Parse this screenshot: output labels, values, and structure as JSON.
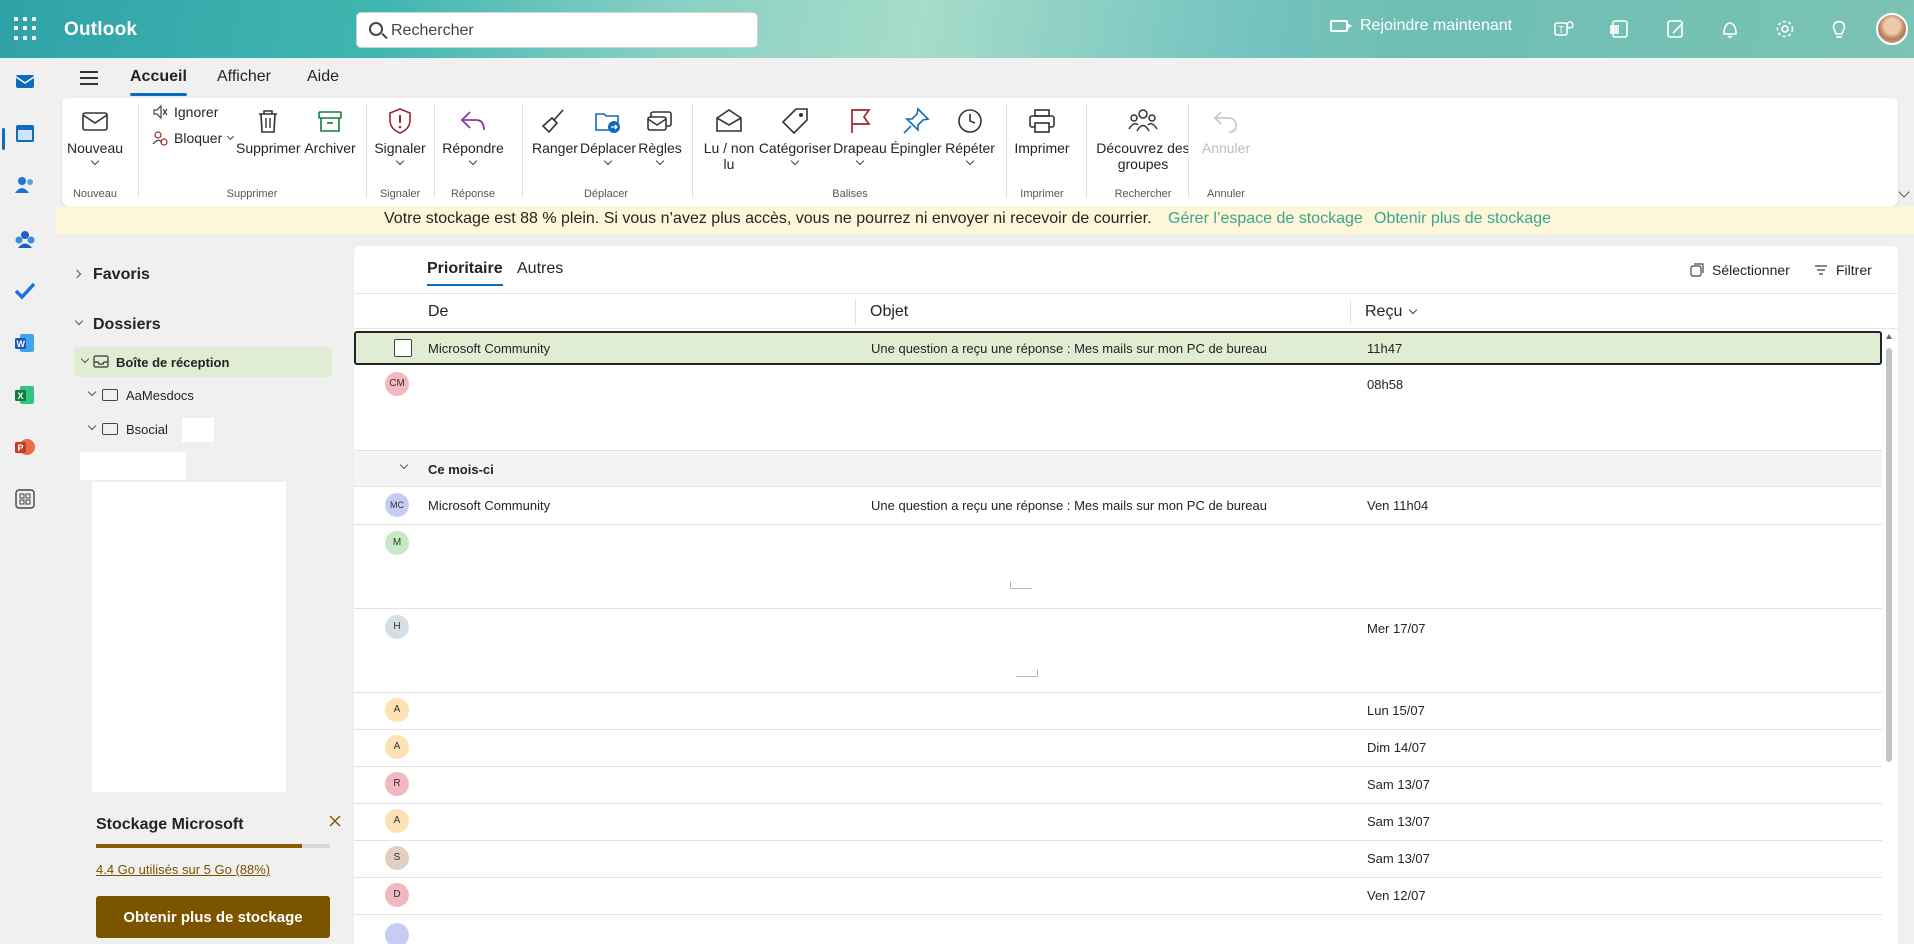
{
  "topbar": {
    "app_name": "Outlook",
    "search_placeholder": "Rechercher",
    "join_label": "Rejoindre maintenant"
  },
  "ribbon": {
    "tabs": [
      "Accueil",
      "Afficher",
      "Aide"
    ],
    "buttons": {
      "nouveau": "Nouveau",
      "ignorer": "Ignorer",
      "bloquer": "Bloquer",
      "supprimer": "Supprimer",
      "archiver": "Archiver",
      "signaler": "Signaler",
      "repondre": "Répondre",
      "ranger": "Ranger",
      "deplacer": "Déplacer",
      "regles": "Règles",
      "lu_non_lu_1": "Lu / non",
      "lu_non_lu_2": "lu",
      "categoriser": "Catégoriser",
      "drapeau": "Drapeau",
      "epingler": "Épingler",
      "repeter": "Répéter",
      "imprimer": "Imprimer",
      "groupes_1": "Découvrez des",
      "groupes_2": "groupes",
      "annuler": "Annuler"
    },
    "groups": {
      "nouveau": "Nouveau",
      "supprimer": "Supprimer",
      "signaler": "Signaler",
      "reponse": "Réponse",
      "deplacer": "Déplacer",
      "balises": "Balises",
      "imprimer": "Imprimer",
      "rechercher": "Rechercher",
      "annuler": "Annuler"
    }
  },
  "banner": {
    "message": "Votre stockage est 88 % plein. Si vous n’avez plus accès, vous ne pourrez ni envoyer ni recevoir de courrier.",
    "link1": "Gérer l’espace de stockage",
    "link2": "Obtenir plus de stockage"
  },
  "folders": {
    "favoris": "Favoris",
    "dossiers": "Dossiers",
    "inbox": "Boîte de réception",
    "f1": "AaMesdocs",
    "f2": "Bsocial"
  },
  "storage": {
    "title": "Stockage Microsoft",
    "used_text": "4.4 Go utilisés sur 5 Go (88%)",
    "used_fraction": 0.88,
    "button": "Obtenir plus de stockage"
  },
  "mail": {
    "tabs": {
      "focused": "Prioritaire",
      "other": "Autres"
    },
    "select_label": "Sélectionner",
    "filter_label": "Filtrer",
    "columns": {
      "from": "De",
      "subject": "Objet",
      "received": "Reçu"
    },
    "section": "Ce mois-ci",
    "rows": [
      {
        "from": "Microsoft Community",
        "subject": "Une question a reçu une réponse : Mes mails sur mon PC de bureau",
        "date": "11h47",
        "initials": ""
      },
      {
        "from": "",
        "subject": "",
        "date": "08h58",
        "initials": "CM"
      },
      {
        "from": "Microsoft Community",
        "subject": "Une question a reçu une réponse : Mes mails sur mon PC de bureau",
        "date": "Ven 11h04",
        "initials": "MC"
      },
      {
        "from": "",
        "subject": "",
        "date": "",
        "initials": "M"
      },
      {
        "from": "",
        "subject": "",
        "date": "Mer 17/07",
        "initials": "H"
      },
      {
        "from": "",
        "subject": "",
        "date": "Lun 15/07",
        "initials": "A"
      },
      {
        "from": "",
        "subject": "",
        "date": "Dim 14/07",
        "initials": "A"
      },
      {
        "from": "",
        "subject": "",
        "date": "Sam 13/07",
        "initials": "R"
      },
      {
        "from": "",
        "subject": "",
        "date": "Sam 13/07",
        "initials": "A"
      },
      {
        "from": "",
        "subject": "",
        "date": "Sam 13/07",
        "initials": "S"
      },
      {
        "from": "",
        "subject": "",
        "date": "Ven 12/07",
        "initials": "D"
      }
    ]
  },
  "colors": {
    "accent": "#0f6cbd",
    "selected_row": "#e0edd3",
    "banner_bg": "#fdf6d8",
    "storage_button": "#7c5400"
  }
}
